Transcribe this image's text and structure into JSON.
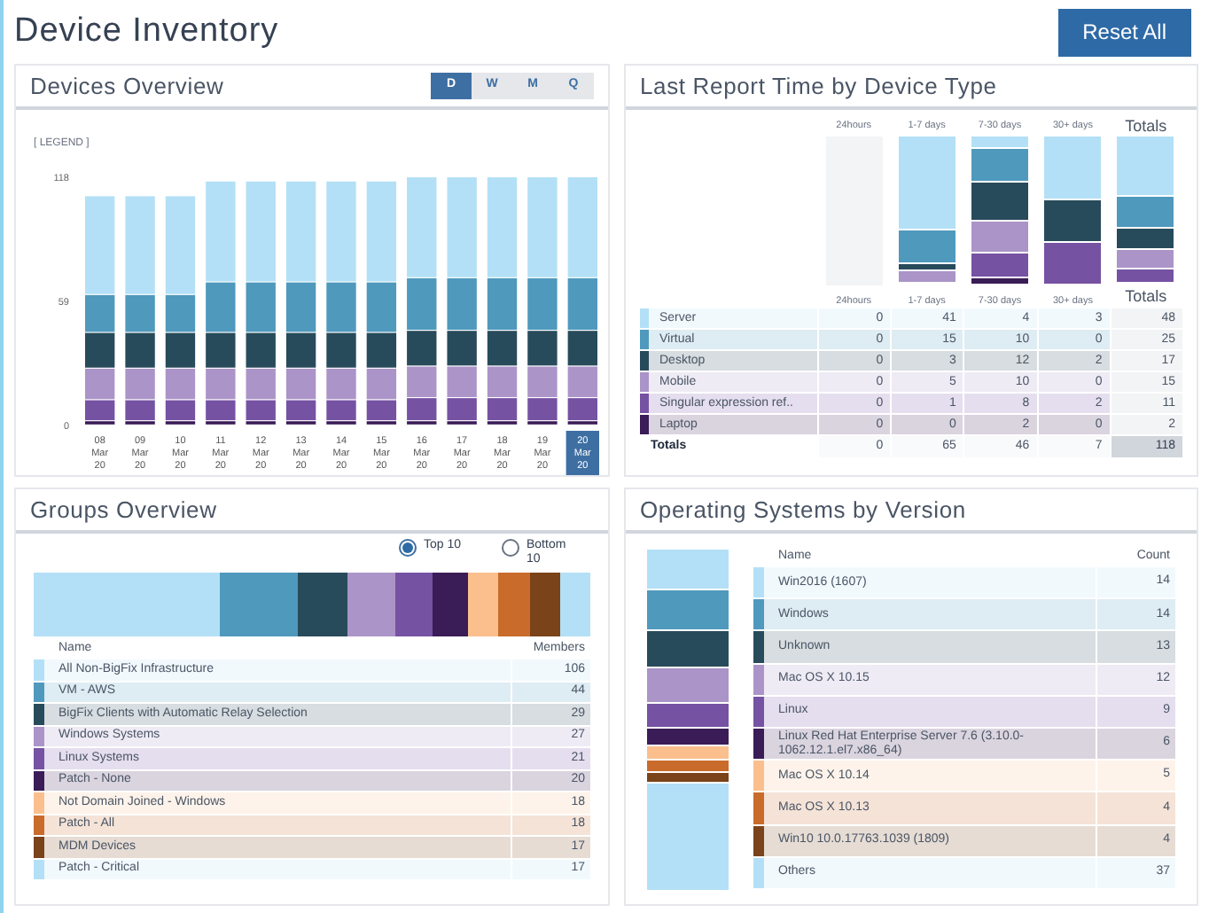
{
  "title": "Device Inventory",
  "reset_button": "Reset All",
  "devices_overview": {
    "title": "Devices Overview",
    "periods": [
      {
        "label": "D",
        "selected": true
      },
      {
        "label": "W",
        "selected": false
      },
      {
        "label": "M",
        "selected": false
      },
      {
        "label": "Q",
        "selected": false
      }
    ],
    "legend": "[ LEGEND ]",
    "category_selected": [
      false,
      false,
      false,
      false,
      false,
      false,
      false,
      false,
      false,
      false,
      false,
      false,
      true
    ],
    "chart_data": {
      "type": "bar",
      "stacked": true,
      "categories": [
        "08 Mar 20",
        "09 Mar 20",
        "10 Mar 20",
        "11 Mar 20",
        "12 Mar 20",
        "13 Mar 20",
        "14 Mar 20",
        "15 Mar 20",
        "16 Mar 20",
        "17 Mar 20",
        "18 Mar 20",
        "19 Mar 20",
        "20 Mar 20"
      ],
      "series": [
        {
          "color": "#3a1c57",
          "values": [
            2,
            2,
            2,
            2,
            2,
            2,
            2,
            2,
            2,
            2,
            2,
            2,
            2
          ]
        },
        {
          "color": "#7652a3",
          "values": [
            10,
            10,
            10,
            10,
            10,
            10,
            10,
            10,
            11,
            11,
            11,
            11,
            11
          ]
        },
        {
          "color": "#ab94c8",
          "values": [
            15,
            15,
            15,
            15,
            15,
            15,
            15,
            15,
            15,
            15,
            15,
            15,
            15
          ]
        },
        {
          "color": "#284b5b",
          "values": [
            17,
            17,
            17,
            17,
            17,
            17,
            17,
            17,
            17,
            17,
            17,
            17,
            17
          ]
        },
        {
          "color": "#4f99bd",
          "values": [
            18,
            18,
            18,
            24,
            24,
            24,
            24,
            24,
            25,
            25,
            25,
            25,
            25
          ]
        },
        {
          "color": "#b3e0f6",
          "values": [
            47,
            47,
            47,
            48,
            48,
            48,
            48,
            48,
            48,
            48,
            48,
            48,
            48
          ]
        }
      ],
      "ylim": [
        0,
        118
      ],
      "yticks": [
        0,
        59,
        118
      ]
    }
  },
  "last_report": {
    "title": "Last Report Time by Device Type",
    "chart_columns": [
      "24hours",
      "1-7 days",
      "7-30 days",
      "30+ days",
      "Totals"
    ],
    "columns": [
      "24hours",
      "1-7 days",
      "7-30 days",
      "30+ days",
      "Totals"
    ],
    "rows": [
      {
        "name": "Server",
        "color": "#b3e0f6",
        "values": [
          "0",
          "41",
          "4",
          "3",
          "48"
        ]
      },
      {
        "name": "Virtual",
        "color": "#4f99bd",
        "values": [
          "0",
          "15",
          "10",
          "0",
          "25"
        ]
      },
      {
        "name": "Desktop",
        "color": "#284b5b",
        "values": [
          "0",
          "3",
          "12",
          "2",
          "17"
        ]
      },
      {
        "name": "Mobile",
        "color": "#ab94c8",
        "values": [
          "0",
          "5",
          "10",
          "0",
          "15"
        ]
      },
      {
        "name": "Singular expression ref..",
        "color": "#7652a3",
        "values": [
          "0",
          "1",
          "8",
          "2",
          "11"
        ]
      },
      {
        "name": "Laptop",
        "color": "#3a1c57",
        "values": [
          "0",
          "0",
          "2",
          "0",
          "2"
        ]
      }
    ],
    "totals": {
      "label": "Totals",
      "values": [
        "0",
        "65",
        "46",
        "7",
        "118"
      ]
    }
  },
  "groups": {
    "title": "Groups Overview",
    "options": [
      {
        "label": "Top 10",
        "selected": true
      },
      {
        "label": "Bottom 10",
        "selected": false
      }
    ],
    "columns": [
      "Name",
      "Members"
    ],
    "items": [
      {
        "name": "All Non-BigFix Infrastructure",
        "count": "106",
        "color": "#b3e0f6"
      },
      {
        "name": "VM - AWS",
        "count": "44",
        "color": "#4f99bd"
      },
      {
        "name": "BigFix Clients with Automatic Relay Selection",
        "count": "29",
        "color": "#284b5b"
      },
      {
        "name": "Windows Systems",
        "count": "27",
        "color": "#ab94c8"
      },
      {
        "name": "Linux Systems",
        "count": "21",
        "color": "#7652a3"
      },
      {
        "name": "Patch - None",
        "count": "20",
        "color": "#3a1c57"
      },
      {
        "name": "Not Domain Joined - Windows",
        "count": "18",
        "color": "#fbbf8e"
      },
      {
        "name": "Patch - All",
        "count": "18",
        "color": "#c96b2b"
      },
      {
        "name": "MDM Devices",
        "count": "17",
        "color": "#7a431a"
      },
      {
        "name": "Patch - Critical",
        "count": "17",
        "color": "#b3e0f6"
      }
    ]
  },
  "os": {
    "title": "Operating Systems by Version",
    "columns": [
      "Name",
      "Count"
    ],
    "items": [
      {
        "name": "Win2016 (1607)",
        "count": "14",
        "color": "#b3e0f6"
      },
      {
        "name": "Windows",
        "count": "14",
        "color": "#4f99bd"
      },
      {
        "name": "Unknown",
        "count": "13",
        "color": "#284b5b"
      },
      {
        "name": "Mac OS X 10.15",
        "count": "12",
        "color": "#ab94c8"
      },
      {
        "name": "Linux",
        "count": "9",
        "color": "#7652a3"
      },
      {
        "name": "Linux Red Hat Enterprise Server 7.6 (3.10.0-1062.12.1.el7.x86_64)",
        "count": "6",
        "color": "#3a1c57"
      },
      {
        "name": "Mac OS X 10.14",
        "count": "5",
        "color": "#fbbf8e"
      },
      {
        "name": "Mac OS X 10.13",
        "count": "4",
        "color": "#c96b2b"
      },
      {
        "name": "Win10 10.0.17763.1039 (1809)",
        "count": "4",
        "color": "#7a431a"
      },
      {
        "name": "Others",
        "count": "37",
        "color": "#b3e0f6"
      }
    ]
  }
}
